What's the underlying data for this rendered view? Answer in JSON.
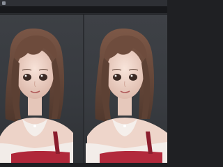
{
  "window": {
    "title": "",
    "icon": "app-icon"
  },
  "viewer": {
    "panes": [
      {
        "label": "",
        "image": "portrait-original"
      },
      {
        "label": "",
        "image": "portrait-enhanced"
      }
    ]
  },
  "colors": {
    "background": "#1f2023",
    "titlebar": "#2e3035",
    "hair": "#6b4a3a",
    "skin": "#efd6cc",
    "dress_red": "#b0283a",
    "blouse": "#f2ece8"
  }
}
